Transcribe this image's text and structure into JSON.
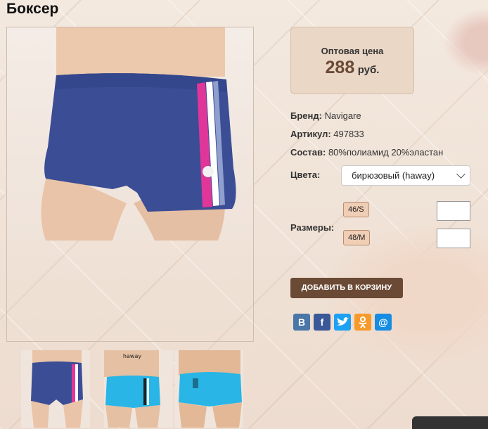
{
  "product": {
    "title": "Боксер",
    "thumb2_label": "haway"
  },
  "price": {
    "label": "Оптовая цена",
    "value": "288",
    "currency": "руб."
  },
  "props": {
    "brand_label": "Бренд:",
    "brand_value": "Navigare",
    "sku_label": "Артикул:",
    "sku_value": "497833",
    "composition_label": "Состав:",
    "composition_value": "80%полиамид 20%эластан",
    "colors_label": "Цвета:",
    "color_selected": "бирюзовый (haway)",
    "sizes_label": "Размеры:",
    "sizes": [
      "46/S",
      "48/M"
    ]
  },
  "actions": {
    "add_to_cart": "ДОБАВИТЬ В КОРЗИНУ"
  },
  "share": {
    "icons": [
      "vk-icon",
      "facebook-icon",
      "twitter-icon",
      "odnoklassniki-icon",
      "mail-icon"
    ],
    "colors": [
      "#4a76a8",
      "#3b5998",
      "#1da1f2",
      "#f59a2b",
      "#168de2"
    ]
  }
}
